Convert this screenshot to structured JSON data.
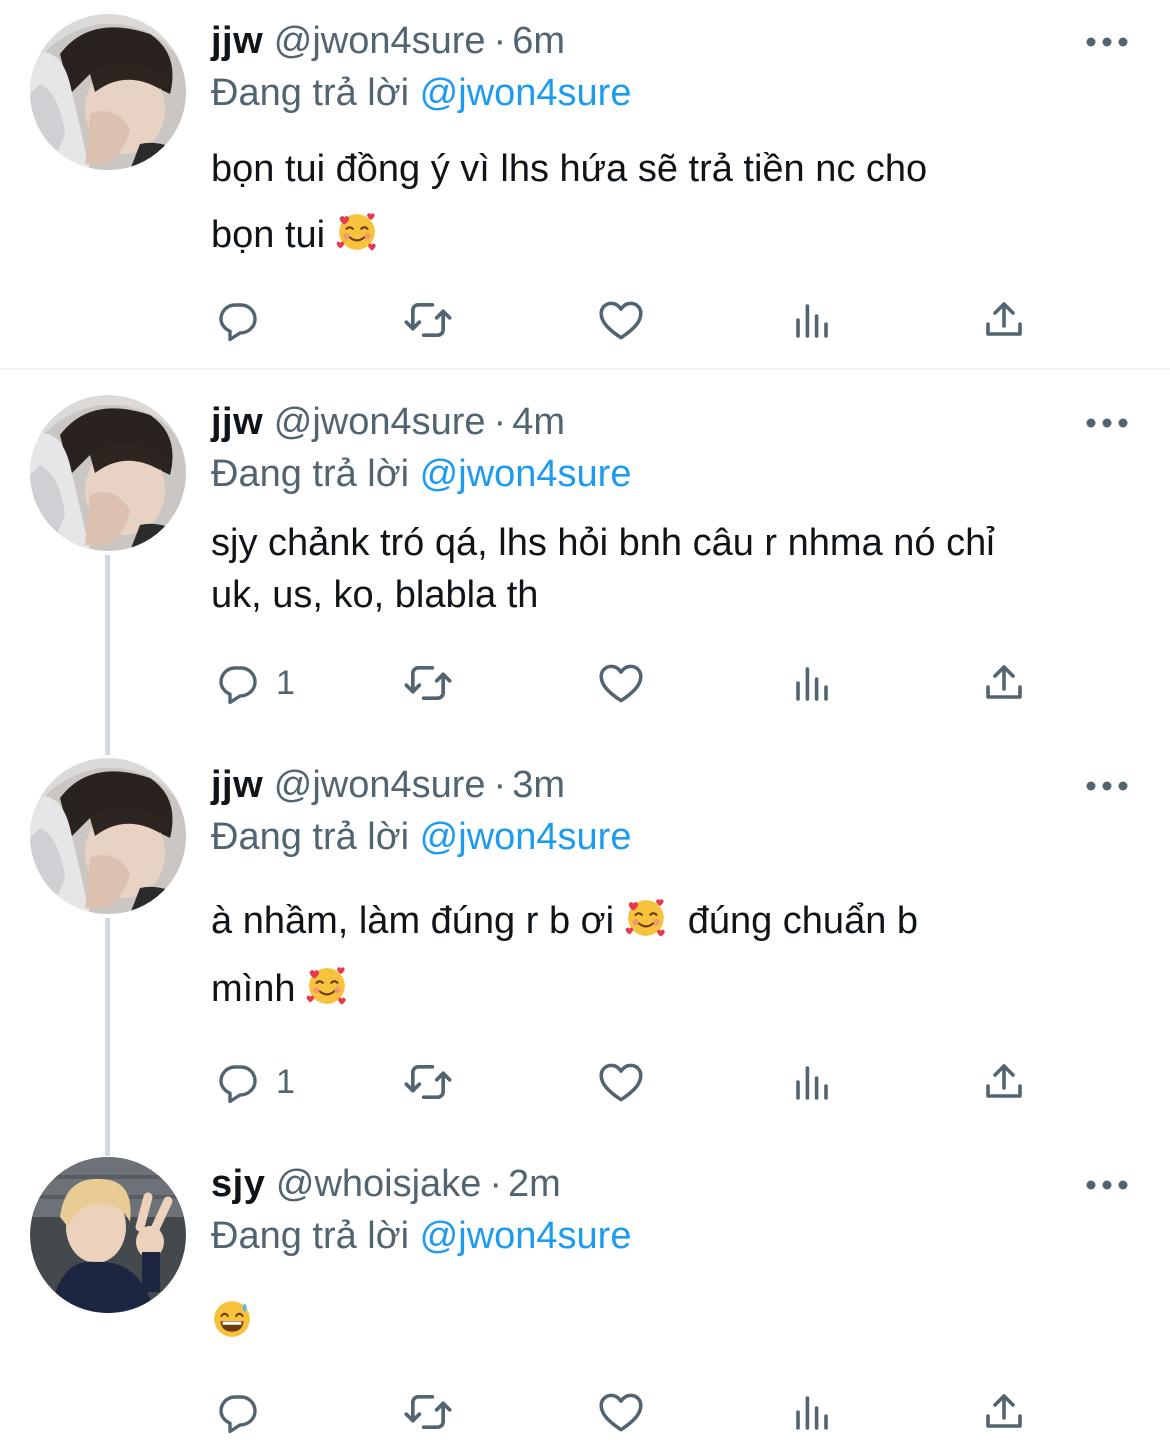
{
  "colors": {
    "link": "#1d9bf0",
    "secondary": "#536471",
    "text": "#0f1419",
    "thread_line": "#cfd9de"
  },
  "icons": {
    "reply": "reply-icon",
    "retweet": "retweet-icon",
    "like": "heart-icon",
    "views": "views-icon",
    "share": "share-icon",
    "more": "more-icon",
    "emoji_hearts": "smiling-face-with-hearts-emoji",
    "emoji_sweat": "grinning-face-with-sweat-emoji"
  },
  "tweets": [
    {
      "name": "jjw",
      "handle": "@jwon4sure",
      "sep": "·",
      "time": "6m",
      "replying_label": "Đang trả lời",
      "replying_to": "@jwon4sure",
      "line1": "bọn tui đồng ý vì lhs hứa sẽ trả tiền nc cho",
      "line2": "bọn tui",
      "reply_count": ""
    },
    {
      "name": "jjw",
      "handle": "@jwon4sure",
      "sep": "·",
      "time": "4m",
      "replying_label": "Đang trả lời",
      "replying_to": "@jwon4sure",
      "line1": "sjy chảnk tró qá, lhs hỏi bnh câu r nhma nó chỉ",
      "line2": "uk, us, ko, blabla th",
      "reply_count": "1"
    },
    {
      "name": "jjw",
      "handle": "@jwon4sure",
      "sep": "·",
      "time": "3m",
      "replying_label": "Đang trả lời",
      "replying_to": "@jwon4sure",
      "line1a": "à nhầm, làm đúng r b ơi",
      "line1b": "đúng chuẩn b",
      "line2": "mình",
      "reply_count": "1"
    },
    {
      "name": "sjy",
      "handle": "@whoisjake",
      "sep": "·",
      "time": "2m",
      "replying_label": "Đang trả lời",
      "replying_to": "@jwon4sure",
      "reply_count": ""
    }
  ]
}
